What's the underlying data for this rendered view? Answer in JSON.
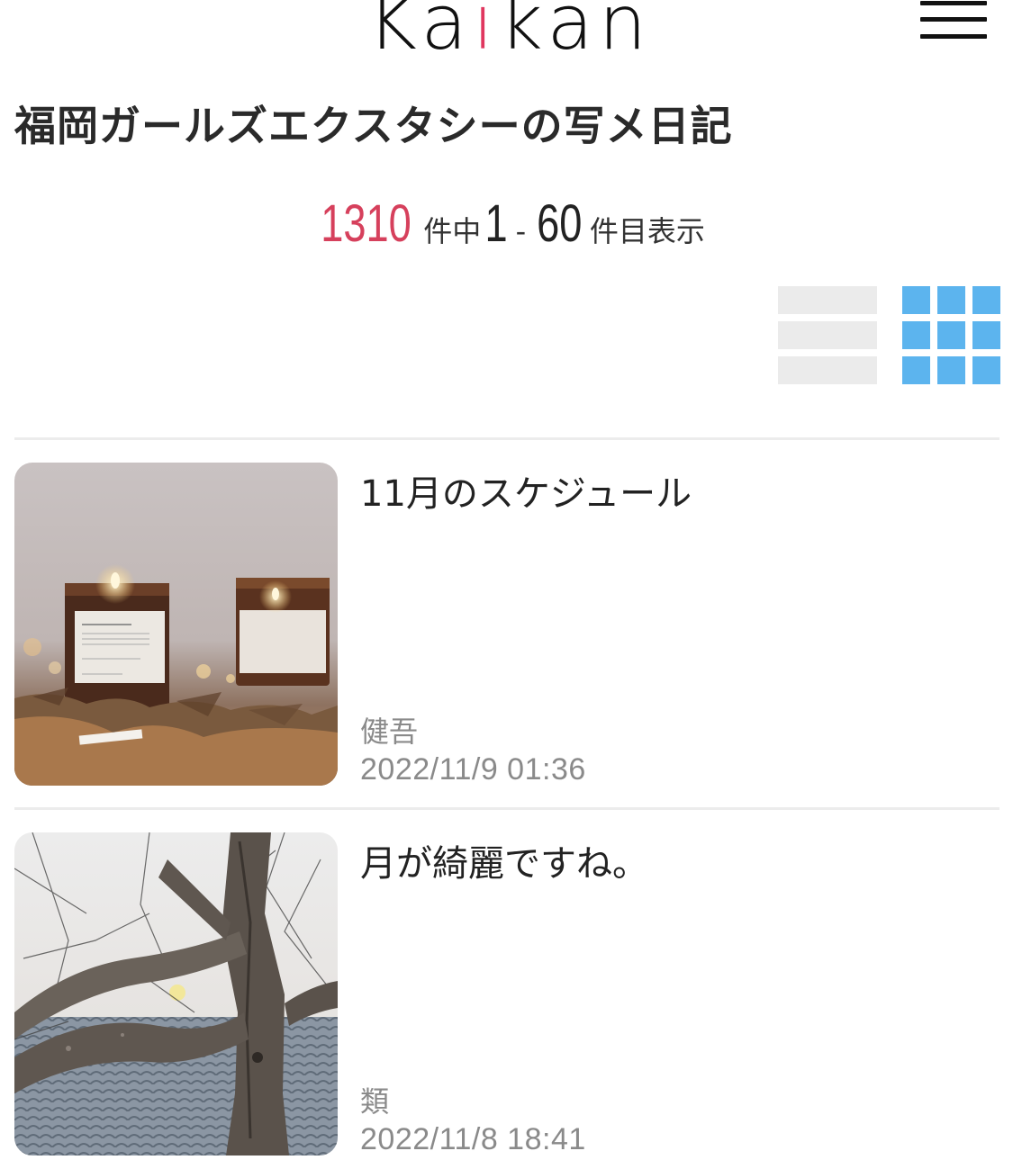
{
  "header": {
    "logo_prefix": "Ka",
    "logo_accent": "i",
    "logo_suffix": "kan",
    "accent_color": "#e0375f",
    "menu_icon": "hamburger-menu-icon"
  },
  "page_title": "福岡ガールズエクスタシーの写メ日記",
  "results": {
    "total": "1310",
    "total_suffix": "件中",
    "from": "1",
    "separator": "-",
    "to": "60",
    "to_suffix": "件目表示",
    "total_color": "#d6405c"
  },
  "view_toggle": {
    "list_icon": "list-view-icon",
    "grid_icon": "grid-view-icon",
    "active": "grid",
    "active_color": "#5cb4ee",
    "inactive_color": "#ebebeb"
  },
  "posts": [
    {
      "title": "11月のスケジュール",
      "author": "健吾",
      "date": "2022/11/9 01:36",
      "thumbnail": "candles-photo"
    },
    {
      "title": "月が綺麗ですね。",
      "author": "類",
      "date": "2022/11/8 18:41",
      "thumbnail": "tree-moon-photo"
    }
  ]
}
